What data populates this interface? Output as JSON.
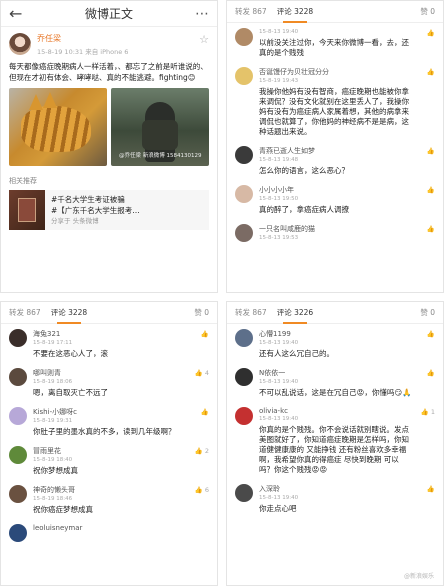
{
  "panelA": {
    "nav": {
      "back_icon": "←",
      "title": "微博正文",
      "more_icon": "⋯"
    },
    "author": {
      "name": "乔任梁",
      "time": "15-8-19 10:31 来自 iPhone 6",
      "avatar_color": "#c8a890"
    },
    "star_icon": "☆",
    "text": "每天都像癌症晚期病人一样活着，、都忘了之前是听谁说的、但现在才初有体会、哮哮哒、真的不能逃避。fighting😊",
    "img_caption": "@乔任梁 新浪微博 1584130129",
    "section_label": "相关推荐",
    "rec": {
      "line1": "#千名大学生考证被骗",
      "line2": "#【广东千名大学生报考…",
      "from": "分享于 头条微博"
    }
  },
  "panelB": {
    "stat": {
      "reposts": "转发 867",
      "comments": "评论 3228",
      "likes": "赞 0"
    },
    "comments": [
      {
        "name": "",
        "time": "15-8-13 19:40",
        "text": "以前没关注过你，今天来你微博一看，去，还真的是个贱残",
        "like": "👍",
        "avatar": "#b08a66"
      },
      {
        "name": "否诞馒仔为贝壮冠分分",
        "time": "15-8-19 19:43",
        "text": "我操你他妈有没有智商，癌症晚期也能被你拿来调侃？没有文化就别在这里丢人了，我操你妈有没有为癌症病人家属着想，其他的病拿来调侃也就算了，你他妈的神经病不是是病，这种话题出来说。",
        "like": "👍",
        "avatar": "#e4c36a"
      },
      {
        "name": "青燕已逝人生如梦",
        "time": "15-8-13 19:48",
        "text": "怎么你的语言，这么恶心？",
        "like": "👍",
        "avatar": "#3a3a3a"
      },
      {
        "name": "小小小小年",
        "time": "15-8-13 19:50",
        "text": "真的醉了，拿癌症病人调撩",
        "like": "👍",
        "avatar": "#d7b9a5"
      },
      {
        "name": "一只名叫咸鹿的猫",
        "time": "15-8-13 19:53",
        "text": "",
        "like": "👍",
        "avatar": "#7b6b64"
      }
    ]
  },
  "panelC": {
    "stat": {
      "reposts": "转发 867",
      "comments": "评论 3228",
      "likes": "赞 0"
    },
    "comments": [
      {
        "name": "海兔321",
        "time": "15-8-19 17:11",
        "text": "不要在这恶心人了，滚",
        "like": "👍",
        "avatar": "#3a2e2a"
      },
      {
        "name": "哪叫则青",
        "time": "15-8-19 18:06",
        "text": "嗯，离自取灭亡不远了",
        "like": "👍 4",
        "avatar": "#5b4a3e"
      },
      {
        "name": "Kishi-小娜呀c",
        "time": "15-8-19 19:31",
        "text": "你肚子里的墨水真的不多，读到几年级啊？",
        "like": "👍",
        "avatar": "#b7a8d8"
      },
      {
        "name": "冒雨里花",
        "time": "15-8-19 18:40",
        "text": "祝你梦想成真",
        "like": "👍 2",
        "avatar": "#5f8a3a"
      },
      {
        "name": "神奇的懒头哥",
        "time": "15-8-19 18:46",
        "text": "祝你癌症梦想成真",
        "like": "👍 6",
        "avatar": "#6a5140"
      },
      {
        "name": "leoluisneymar",
        "time": "",
        "text": "",
        "like": "",
        "avatar": "#2b4a7a"
      }
    ]
  },
  "panelD": {
    "stat": {
      "reposts": "转发 867",
      "comments": "评论 3226",
      "likes": "赞 0"
    },
    "comments": [
      {
        "name": "心懵1199",
        "time": "15-8-13 19:40",
        "text": "还有人这么冗自己的。",
        "like": "👍",
        "avatar": "#5d6f8a"
      },
      {
        "name": "N依依一",
        "time": "15-8-13 19:40",
        "text": "不可以乱说话，这是在冗自己😡，你懂吗😏🙏",
        "like": "👍",
        "avatar": "#2f2f2f"
      },
      {
        "name": "olivia-kc",
        "time": "15-8-13 19:40",
        "text": "你真的是个贱残。你不会说话就别瞎说。发点美图就好了，你知道癌症晚期是怎样吗，你知道健健康康的 又能挣钱 还有粉丝喜欢多幸福啊，我希望你真的得癌症 尽快到晚期 可以吗？你这个贱残😡😡",
        "like": "👍 1",
        "avatar": "#c43030"
      },
      {
        "name": "入深聆",
        "time": "15-8-13 19:40",
        "text": "你走点心吧",
        "like": "👍",
        "avatar": "#4a4a4a"
      }
    ]
  },
  "watermark": "@新浪娱乐",
  "colors": {
    "accent": "#f08a24",
    "name_orange": "#e8782a"
  }
}
